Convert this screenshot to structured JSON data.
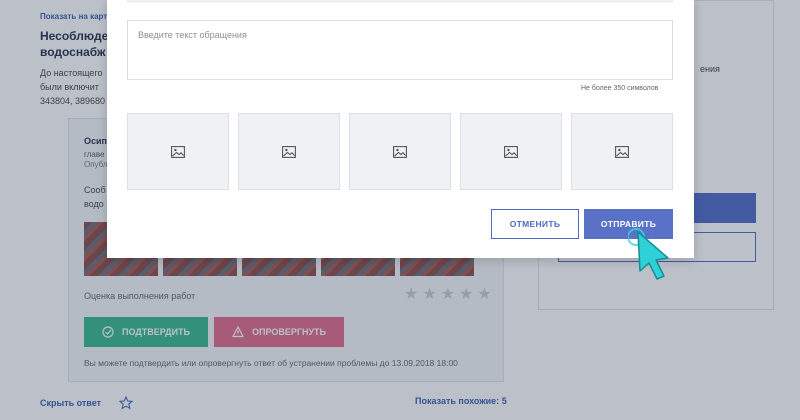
{
  "background": {
    "map_link": "Показать на карт",
    "issue_title_line1": "Несоблюде",
    "issue_title_line2": "водоснабж",
    "issue_desc_line1": "До настоящего",
    "issue_desc_line2": "были включит",
    "issue_desc_line3": "343804, 389680",
    "answer": {
      "author": "Осип",
      "role": "главе",
      "published": "Опубл",
      "text_line1": "Сооб",
      "text_line2": "водо",
      "rating_label": "Оценка выполнения работ",
      "confirm_label": "ПОДТВЕРДИТЬ",
      "refute_label": "ОПРОВЕРГНУТЬ",
      "deadline_note": "Вы можете подтвердить или опровергнуть ответ об устранении проблемы до 13.09.2018 18:00",
      "rating_stars": 0,
      "rating_max": 5
    },
    "hide_answer": "Скрыть ответ",
    "show_similar": "Показать похожие:",
    "similar_count": "5",
    "right_text": "ения"
  },
  "modal": {
    "textarea_placeholder": "Введите текст обращения",
    "char_limit": "Не более 350 символов",
    "photo_slots": [
      "image-placeholder-icon",
      "image-placeholder-icon",
      "image-placeholder-icon",
      "image-placeholder-icon",
      "image-placeholder-icon"
    ],
    "cancel_label": "ОТМЕНИТЬ",
    "send_label": "ОТПРАВИТЬ"
  },
  "colors": {
    "accent": "#5a71c8",
    "link": "#3d5fb0",
    "confirm": "#37b98a",
    "refute": "#e26b88",
    "cursor": "#2fd3d8"
  }
}
